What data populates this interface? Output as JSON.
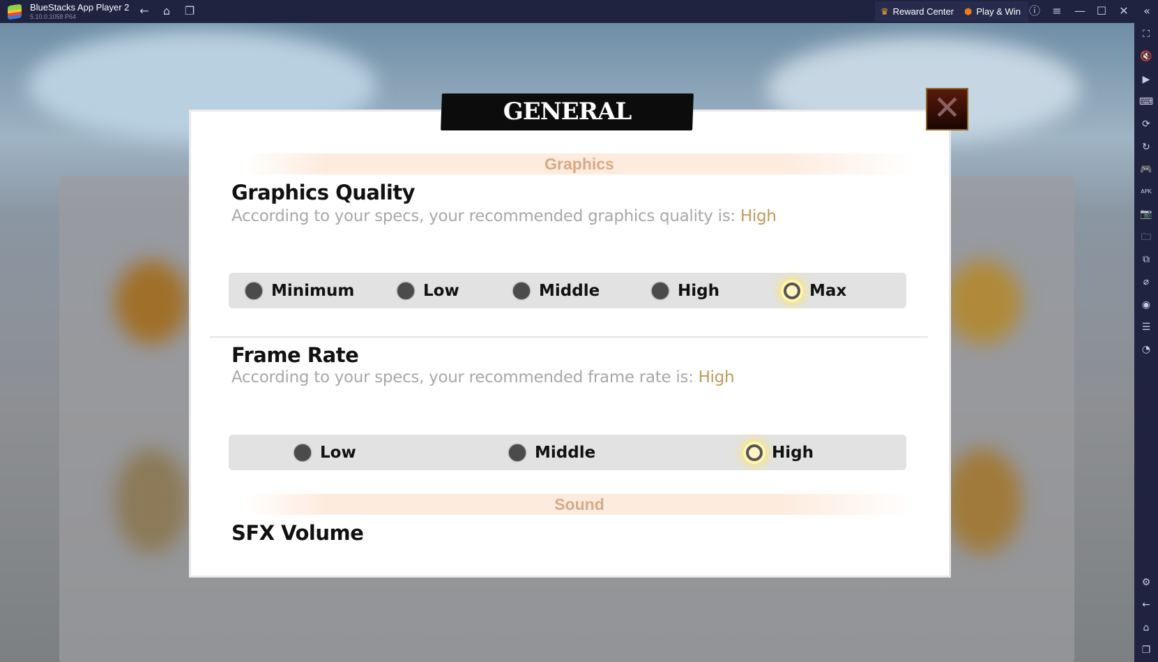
{
  "titlebar": {
    "app_title": "BlueStacks App Player 2",
    "version": "5.10.0.1058  P64",
    "reward_center": "Reward Center",
    "play_win": "Play & Win"
  },
  "sidebar": {
    "icons": [
      "fullscreen-icon",
      "mute-icon",
      "pointer-icon",
      "keyboard-icon",
      "macro-record-icon",
      "rotate-icon",
      "gamepad-icon",
      "apk-icon",
      "screenshot-icon",
      "folder-icon",
      "multi-instance-icon",
      "eco-mode-icon",
      "location-icon",
      "layers-icon",
      "performance-icon",
      "settings-icon",
      "back-icon",
      "home-icon",
      "recent-apps-icon"
    ]
  },
  "dialog": {
    "title": "GENERAL",
    "graphics_header": "Graphics",
    "graphics_quality": {
      "title": "Graphics Quality",
      "desc": "According to your specs, your recommended graphics quality is: ",
      "recommended": "High",
      "options": [
        "Minimum",
        "Low",
        "Middle",
        "High",
        "Max"
      ],
      "selected": "Max"
    },
    "frame_rate": {
      "title": "Frame Rate",
      "desc": "According to your specs, your recommended frame rate is: ",
      "recommended": "High",
      "options": [
        "Low",
        "Middle",
        "High"
      ],
      "selected": "High"
    },
    "sound_header": "Sound",
    "sfx_volume": {
      "title": "SFX Volume"
    }
  },
  "colors": {
    "accent": "#c09a5a",
    "section_header": "#d6ab86",
    "titlebar": "#1f2340"
  }
}
